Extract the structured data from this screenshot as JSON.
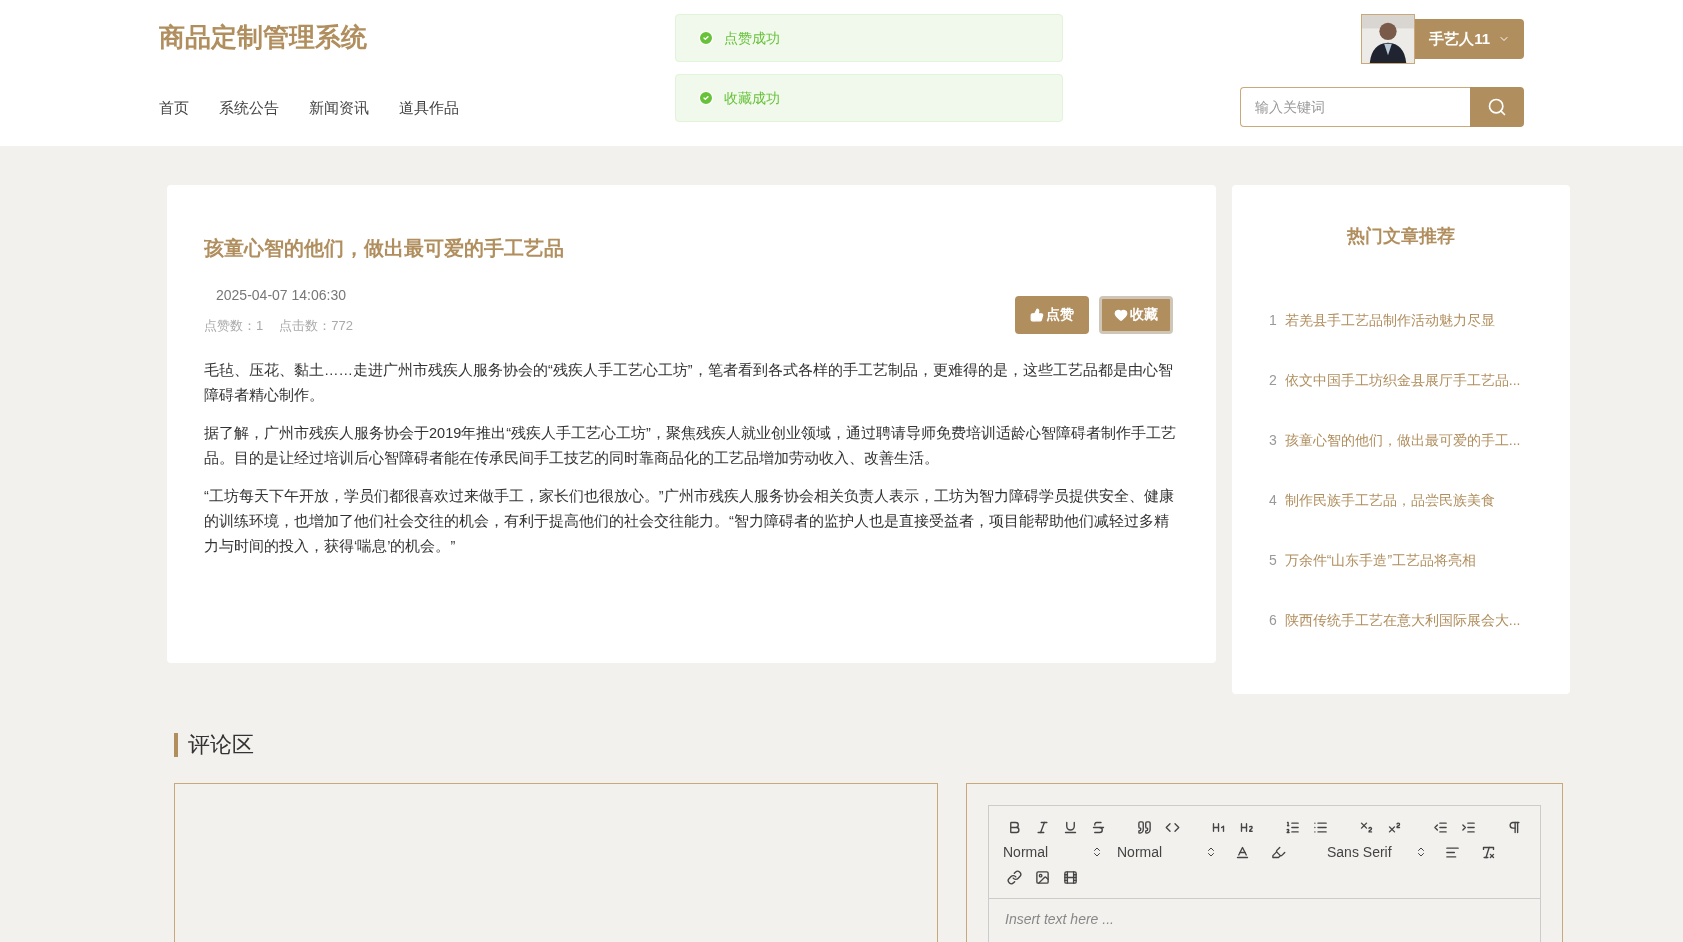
{
  "header": {
    "site_title": "商品定制管理系统",
    "nav": [
      "首页",
      "系统公告",
      "新闻资讯",
      "道具作品"
    ],
    "toasts": [
      "点赞成功",
      "收藏成功"
    ],
    "user": {
      "name": "手艺人11"
    },
    "search": {
      "placeholder": "输入关键词"
    }
  },
  "article": {
    "title": "孩童心智的他们，做出最可爱的手工艺品",
    "date": "2025-04-07 14:06:30",
    "likes": "点赞数：1",
    "clicks": "点击数：772",
    "actions": [
      {
        "kind": "like",
        "label": "点赞",
        "focused": false
      },
      {
        "kind": "favorite",
        "label": "收藏",
        "focused": true
      }
    ],
    "paragraphs": [
      "毛毡、压花、黏土……走进广州市残疾人服务协会的“残疾人手工艺心工坊”，笔者看到各式各样的手工艺制品，更难得的是，这些工艺品都是由心智障碍者精心制作。",
      "据了解，广州市残疾人服务协会于2019年推出“残疾人手工艺心工坊”，聚焦残疾人就业创业领域，通过聘请导师免费培训适龄心智障碍者制作手工艺品。目的是让经过培训后心智障碍者能在传承民间手工技艺的同时靠商品化的工艺品增加劳动收入、改善生活。",
      "“工坊每天下午开放，学员们都很喜欢过来做手工，家长们也很放心。”广州市残疾人服务协会相关负责人表示，工坊为智力障碍学员提供安全、健康的训练环境，也增加了他们社会交往的机会，有利于提高他们的社会交往能力。“智力障碍者的监护人也是直接受益者，项目能帮助他们减轻过多精力与时间的投入，获得‘喘息’的机会。”"
    ]
  },
  "sidebar": {
    "title": "热门文章推荐",
    "items": [
      {
        "index": "1",
        "title": "若羌县手工艺品制作活动魅力尽显"
      },
      {
        "index": "2",
        "title": "依文中国手工坊织金县展厅手工艺品..."
      },
      {
        "index": "3",
        "title": "孩童心智的他们，做出最可爱的手工..."
      },
      {
        "index": "4",
        "title": "制作民族手工艺品，品尝民族美食"
      },
      {
        "index": "5",
        "title": "万余件“山东手造”工艺品将亮相"
      },
      {
        "index": "6",
        "title": "陕西传统手工艺在意大利国际展会大..."
      }
    ]
  },
  "comments": {
    "title": "评论区",
    "editor": {
      "selects": [
        "Normal",
        "Normal",
        "Sans Serif"
      ],
      "placeholder": "Insert text here ..."
    }
  }
}
